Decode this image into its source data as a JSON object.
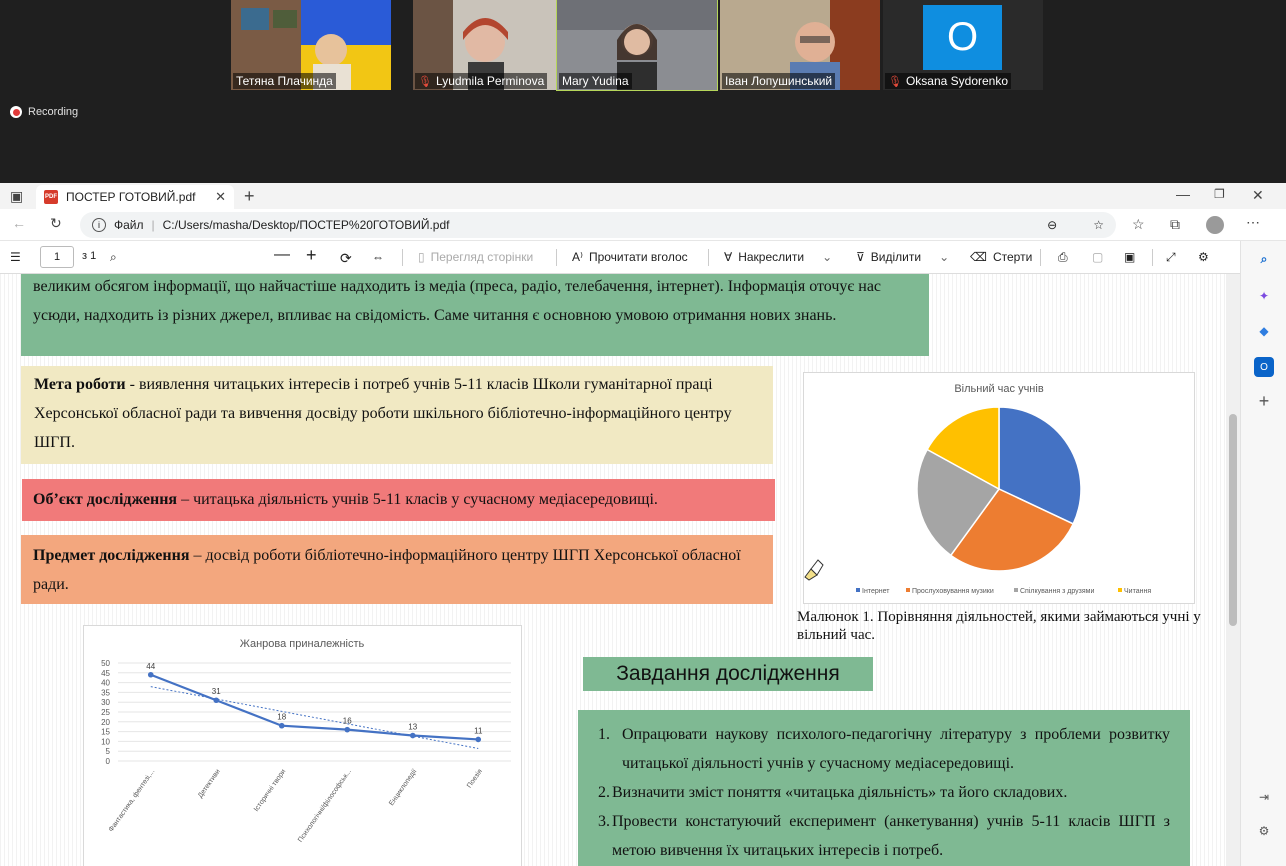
{
  "conference": {
    "participants": [
      {
        "name": "Тетяна Плачинда",
        "muted": false
      },
      {
        "name": "Lyudmila Perminova",
        "muted": true
      },
      {
        "name": "Mary Yudina",
        "muted": false
      },
      {
        "name": "Іван Лопушинський",
        "muted": false
      },
      {
        "name": "Oksana Sydorenko",
        "muted": true,
        "initial": "O"
      }
    ],
    "recording_label": "Recording"
  },
  "browser": {
    "tab_title": "ПОСТЕР ГОТОВИЙ.pdf",
    "tab_icon_label": "PDF",
    "url_prefix": "Файл",
    "url": "C:/Users/masha/Desktop/ПОСТЕР%20ГОТОВИЙ.pdf"
  },
  "pdf_toolbar": {
    "page_current": "1",
    "page_total": "з 1",
    "page_view_label": "Перегляд сторінки",
    "read_aloud_label": "Прочитати вголос",
    "draw_label": "Накреслити",
    "highlight_label": "Виділити",
    "erase_label": "Стерти"
  },
  "document": {
    "intro_line1": "великим обсягом інформації, що найчастіше надходить із медіа (преса, радіо, телебачення, інтернет). Інформація оточує нас",
    "intro_line2": "усюди, надходить із різних джерел, впливає на свідомість. Саме читання є основною умовою  отримання  нових знань.",
    "goal_label": "Мета роботи",
    "goal_text": " - виявлення читацьких інтересів і потреб учнів 5-11 класів Школи гуманітарної праці Херсонської обласної ради та вивчення досвіду роботи шкільного бібліотечно-інформаційного центру ШГП.",
    "object_label": "Об’єкт дослідження",
    "object_text": " – читацька діяльність учнів 5-11 класів у сучасному медіасередовищі.",
    "subject_label": "Предмет дослідження",
    "subject_text": " – досвід роботи бібліотечно-інформаційного центру ШГП Херсонської обласної ради.",
    "caption": "Малюнок 1. Порівняння діяльностей, якими займаються учні у вільний час.",
    "tasks_title": "Завдання дослідження",
    "tasks": [
      {
        "num": "1.",
        "text": "Опрацювати наукову психолого-педагогічну літературу з проблеми розвитку читацької діяльності учнів у сучасному медіасередовищі."
      },
      {
        "num": "2.",
        "text": "Визначити зміст поняття «читацька діяльність» та його складових."
      },
      {
        "num": "3.",
        "text": "Провести констатуючий експеримент (анкетування) учнів 5-11 класів ШГП з метою вивчення їх читацьких інтересів і потреб."
      }
    ]
  },
  "chart_data": [
    {
      "type": "pie",
      "title": "Вільний час учнів",
      "categories": [
        "Інтернет",
        "Прослуховування музики",
        "Спілкування з друзями",
        "Читання"
      ],
      "values": [
        32,
        28,
        23,
        17
      ],
      "colors": [
        "#4472c4",
        "#ed7d31",
        "#a5a5a5",
        "#ffc000"
      ],
      "legend_position": "bottom"
    },
    {
      "type": "line",
      "title": "Жанрова приналежність",
      "categories": [
        "Фантастика, фентезі,...",
        "Детективи",
        "Історичні твори",
        "Психологічні/філософськ...",
        "Енциклопедії",
        "Поезія"
      ],
      "series": [
        {
          "values": [
            44,
            31,
            18,
            16,
            13,
            11
          ]
        }
      ],
      "trendline": "linear",
      "ylim": [
        0,
        50
      ],
      "yticks": [
        0,
        5,
        10,
        15,
        20,
        25,
        30,
        35,
        40,
        45,
        50
      ],
      "grid": true,
      "color": "#4472c4"
    }
  ]
}
